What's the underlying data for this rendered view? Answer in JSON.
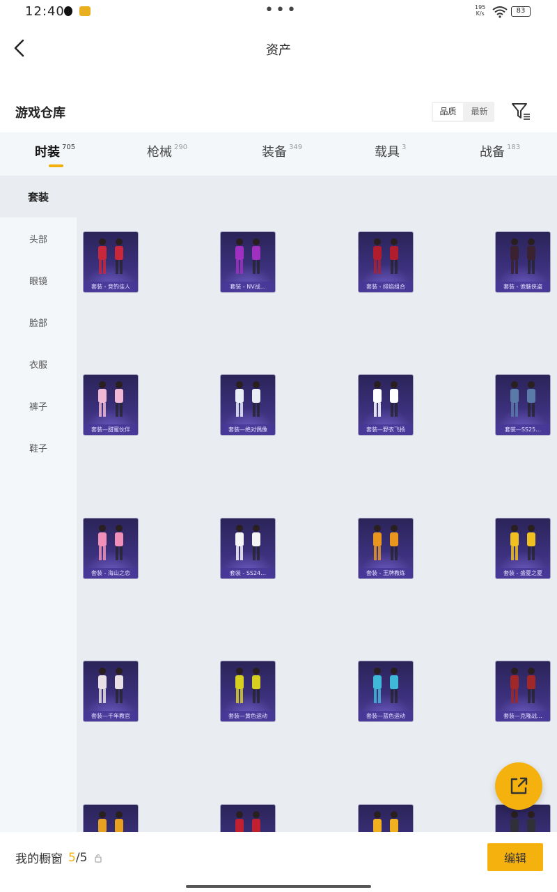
{
  "status": {
    "time": "12:40",
    "net_speed_value": "195",
    "net_speed_unit": "K/s",
    "battery": "83"
  },
  "header": {
    "title": "资产"
  },
  "section": {
    "title": "游戏仓库",
    "sort_quality": "品质",
    "sort_latest": "最新"
  },
  "tabs": [
    {
      "label": "时装",
      "count": "705"
    },
    {
      "label": "枪械",
      "count": "290"
    },
    {
      "label": "装备",
      "count": "349"
    },
    {
      "label": "载具",
      "count": "3"
    },
    {
      "label": "战备",
      "count": "183"
    }
  ],
  "sidebar": [
    {
      "label": "套装"
    },
    {
      "label": "头部"
    },
    {
      "label": "眼镜"
    },
    {
      "label": "脸部"
    },
    {
      "label": "衣服"
    },
    {
      "label": "裤子"
    },
    {
      "label": "鞋子"
    }
  ],
  "items": [
    {
      "name": "套装 - 竞钓佳人",
      "accent": "#c8283a"
    },
    {
      "name": "套装 - NV战…",
      "accent": "#a030c0"
    },
    {
      "name": "套装 - 绯焰组合",
      "accent": "#b01e2e"
    },
    {
      "name": "套装 - 诡魅侠盗",
      "accent": "#3a2230"
    },
    {
      "name": "套装—甜蜜伙伴",
      "accent": "#f0b8d4"
    },
    {
      "name": "套装—绝对偶像",
      "accent": "#e8eef4"
    },
    {
      "name": "套装—野衣飞扬",
      "accent": "#ffffff"
    },
    {
      "name": "套装—SS25…",
      "accent": "#5a7aa8"
    },
    {
      "name": "套装 - 海山之恋",
      "accent": "#f090b8"
    },
    {
      "name": "套装 - SS24…",
      "accent": "#f4f4f4"
    },
    {
      "name": "套装 - 王牌教练",
      "accent": "#e8961e"
    },
    {
      "name": "套装 - 盛夏之夏",
      "accent": "#f0c020"
    },
    {
      "name": "套装—千年教官",
      "accent": "#e8e0e4"
    },
    {
      "name": "套装—黄色运动",
      "accent": "#d8d020"
    },
    {
      "name": "套装—蓝色运动",
      "accent": "#40b8d8"
    },
    {
      "name": "套装—克隆战…",
      "accent": "#a02828"
    },
    {
      "name": "",
      "accent": "#e8a020"
    },
    {
      "name": "",
      "accent": "#c02030"
    },
    {
      "name": "",
      "accent": "#f0b020"
    },
    {
      "name": "",
      "accent": "#303038"
    }
  ],
  "bottom": {
    "showcase_label": "我的橱窗",
    "showcase_count": "5",
    "showcase_sep": "/",
    "showcase_total": "5",
    "edit_label": "编辑"
  },
  "colors": {
    "accent": "#f5b20f",
    "card": "#3a2f7a"
  }
}
